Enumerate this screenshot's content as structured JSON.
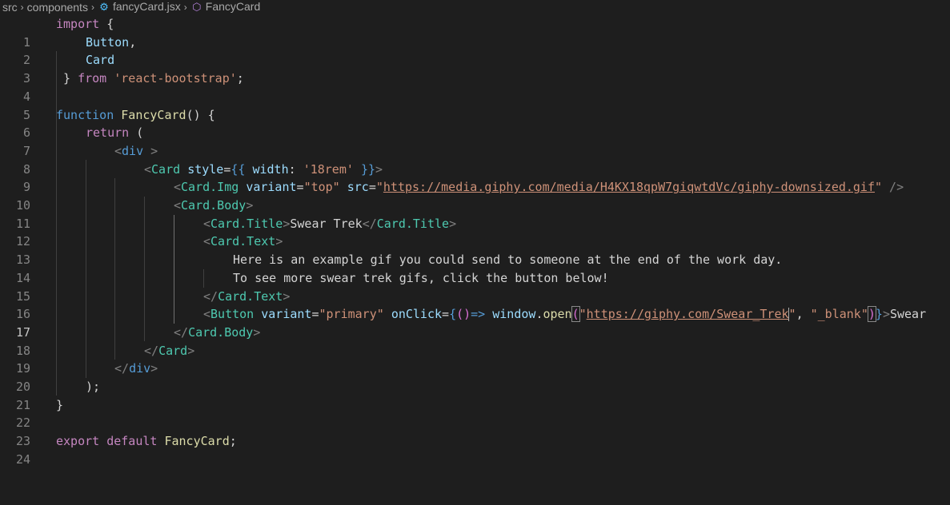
{
  "breadcrumb": {
    "items": [
      "src",
      "components",
      "fancyCard.jsx",
      "FancyCard"
    ],
    "icons": [
      "react-gear-icon",
      "symbol-class-icon"
    ]
  },
  "editor": {
    "active_line": 17,
    "line_numbers": [
      "1",
      "2",
      "3",
      "4",
      "5",
      "6",
      "7",
      "8",
      "9",
      "10",
      "11",
      "12",
      "13",
      "14",
      "15",
      "16",
      "17",
      "18",
      "19",
      "20",
      "21",
      "22",
      "23",
      "24"
    ],
    "tokens": {
      "l1": [
        "import",
        " {"
      ],
      "l2": [
        "Button",
        ","
      ],
      "l3": [
        "Card"
      ],
      "l4": [
        " } ",
        "from",
        " ",
        "'react-bootstrap'",
        ";"
      ],
      "l6": [
        "function",
        " ",
        "FancyCard",
        "() {"
      ],
      "l7": [
        "return",
        " ("
      ],
      "l8": [
        "<",
        "div",
        " >"
      ],
      "l9": [
        "<",
        "Card",
        " ",
        "style",
        "=",
        "{{",
        " ",
        "width",
        ": ",
        "'18rem'",
        " ",
        "}}",
        ">"
      ],
      "l10": [
        "<",
        "Card.Img",
        " ",
        "variant",
        "=",
        "\"top\"",
        " ",
        "src",
        "=",
        "\"",
        "https://media.giphy.com/media/H4KX18qpW7giqwtdVc/giphy-downsized.gif",
        "\"",
        " />"
      ],
      "l11": [
        "<",
        "Card.Body",
        ">"
      ],
      "l12": [
        "<",
        "Card.Title",
        ">",
        "Swear Trek",
        "</",
        "Card.Title",
        ">"
      ],
      "l13": [
        "<",
        "Card.Text",
        ">"
      ],
      "l14": [
        "Here is an example gif you could send to someone at the end of the work day."
      ],
      "l15": [
        "To see more swear trek gifs, click the button below!"
      ],
      "l16": [
        "</",
        "Card.Text",
        ">"
      ],
      "l17": [
        "<",
        "Button",
        " ",
        "variant",
        "=",
        "\"primary\"",
        " ",
        "onClick",
        "=",
        "{",
        "()",
        "=>",
        " ",
        "window",
        ".",
        "open",
        "(",
        "\"",
        "https://giphy.com/Swear_Trek",
        "\"",
        ", ",
        "\"_blank\"",
        ")",
        "}",
        ">",
        "Swear"
      ],
      "l18": [
        "</",
        "Card.Body",
        ">"
      ],
      "l19": [
        "</",
        "Card",
        ">"
      ],
      "l20": [
        "</",
        "div",
        ">"
      ],
      "l21": [
        ");"
      ],
      "l22": [
        "}"
      ],
      "l24": [
        "export",
        " ",
        "default",
        " ",
        "FancyCard",
        ";"
      ]
    }
  },
  "colors": {
    "background": "#1e1e1e",
    "keyword": "#c586c0",
    "storage": "#569cd6",
    "function": "#dcdcaa",
    "variable": "#9cdcfe",
    "string": "#ce9178",
    "tag": "#4ec9b0",
    "punctuation": "#808080"
  }
}
